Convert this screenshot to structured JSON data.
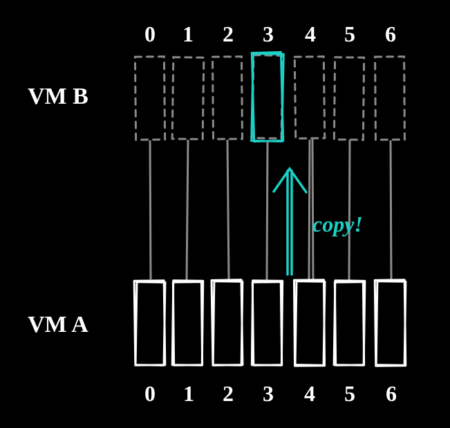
{
  "labels": {
    "vm_top": "VM B",
    "vm_bottom": "VM A",
    "copy": "copy!"
  },
  "indices_top": [
    "0",
    "1",
    "2",
    "3",
    "4",
    "5",
    "6"
  ],
  "indices_bottom": [
    "0",
    "1",
    "2",
    "3",
    "4",
    "5",
    "6"
  ],
  "highlight_index": 3,
  "colors": {
    "accent": "#1ad1c7",
    "fg": "#ffffff",
    "muted": "#8a8a8a"
  }
}
